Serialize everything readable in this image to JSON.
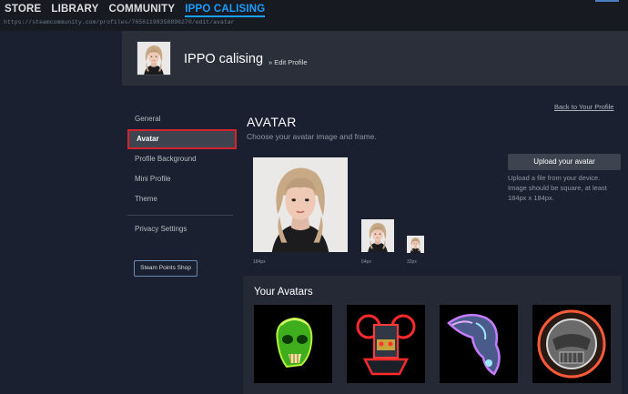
{
  "nav": {
    "items": [
      "STORE",
      "LIBRARY",
      "COMMUNITY",
      "IPPO CALISING"
    ],
    "active_index": 3
  },
  "url": "https://steamcommunity.com/profiles/76561198358896270/edit/avatar",
  "header": {
    "username": "IPPO calising",
    "breadcrumb": "» Edit Profile"
  },
  "sidebar": {
    "items": [
      "General",
      "Avatar",
      "Profile Background",
      "Mini Profile",
      "Theme"
    ],
    "selected_index": 1,
    "privacy": "Privacy Settings",
    "points_shop": "Steam Points Shop"
  },
  "back_link": "Back to Your Profile",
  "avatar_section": {
    "title": "AVATAR",
    "subtitle": "Choose your avatar image and frame.",
    "sizes": [
      "184px",
      "64px",
      "32px"
    ]
  },
  "upload": {
    "button": "Upload your avatar",
    "hint": "Upload a file from your device. Image should be square, at least 184px x 184px."
  },
  "your_avatars": {
    "title": "Your Avatars",
    "items": [
      "green-skull-avatar",
      "red-neon-robot-avatar",
      "purple-horn-creature-avatar",
      "red-ring-armor-avatar"
    ]
  },
  "colors": {
    "active_nav": "#1a9fff",
    "selected_outline": "#d1242f",
    "background": "#1b2030"
  }
}
